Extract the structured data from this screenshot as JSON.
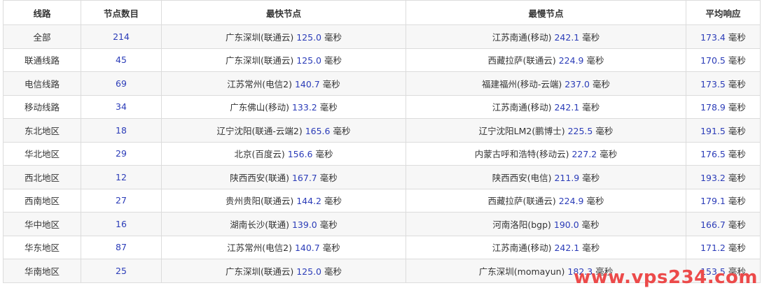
{
  "headers": {
    "line": "线路",
    "node_count": "节点数目",
    "fastest": "最快节点",
    "slowest": "最慢节点",
    "average": "平均响应"
  },
  "unit": "毫秒",
  "rows": [
    {
      "line": "全部",
      "count": "214",
      "fast_loc": "广东深圳(联通云)",
      "fast_ms": "125.0",
      "slow_loc": "江苏南通(移动)",
      "slow_ms": "242.1",
      "avg_ms": "173.4"
    },
    {
      "line": "联通线路",
      "count": "45",
      "fast_loc": "广东深圳(联通云)",
      "fast_ms": "125.0",
      "slow_loc": "西藏拉萨(联通云)",
      "slow_ms": "224.9",
      "avg_ms": "170.5"
    },
    {
      "line": "电信线路",
      "count": "69",
      "fast_loc": "江苏常州(电信2)",
      "fast_ms": "140.7",
      "slow_loc": "福建福州(移动-云端)",
      "slow_ms": "237.0",
      "avg_ms": "173.5"
    },
    {
      "line": "移动线路",
      "count": "34",
      "fast_loc": "广东佛山(移动)",
      "fast_ms": "133.2",
      "slow_loc": "江苏南通(移动)",
      "slow_ms": "242.1",
      "avg_ms": "178.9"
    },
    {
      "line": "东北地区",
      "count": "18",
      "fast_loc": "辽宁沈阳(联通-云端2)",
      "fast_ms": "165.6",
      "slow_loc": "辽宁沈阳LM2(鹏博士)",
      "slow_ms": "225.5",
      "avg_ms": "191.5"
    },
    {
      "line": "华北地区",
      "count": "29",
      "fast_loc": "北京(百度云)",
      "fast_ms": "156.6",
      "slow_loc": "内蒙古呼和浩特(移动云)",
      "slow_ms": "227.2",
      "avg_ms": "176.5"
    },
    {
      "line": "西北地区",
      "count": "12",
      "fast_loc": "陕西西安(联通)",
      "fast_ms": "167.7",
      "slow_loc": "陕西西安(电信)",
      "slow_ms": "211.9",
      "avg_ms": "193.2"
    },
    {
      "line": "西南地区",
      "count": "27",
      "fast_loc": "贵州贵阳(联通云)",
      "fast_ms": "144.2",
      "slow_loc": "西藏拉萨(联通云)",
      "slow_ms": "224.9",
      "avg_ms": "179.1"
    },
    {
      "line": "华中地区",
      "count": "16",
      "fast_loc": "湖南长沙(联通)",
      "fast_ms": "139.0",
      "slow_loc": "河南洛阳(bgp)",
      "slow_ms": "190.0",
      "avg_ms": "166.7"
    },
    {
      "line": "华东地区",
      "count": "87",
      "fast_loc": "江苏常州(电信2)",
      "fast_ms": "140.7",
      "slow_loc": "江苏南通(移动)",
      "slow_ms": "242.1",
      "avg_ms": "171.2"
    },
    {
      "line": "华南地区",
      "count": "25",
      "fast_loc": "广东深圳(联通云)",
      "fast_ms": "125.0",
      "slow_loc": "广东深圳(momayun)",
      "slow_ms": "182.3",
      "avg_ms": "153.5"
    }
  ],
  "watermark": "www.vps234.com",
  "colors": {
    "number": "#2b3cb8",
    "text": "#333333",
    "stripe": "#f7f7f7",
    "border": "#dcdcdc",
    "watermark": "#ec4a4a"
  }
}
